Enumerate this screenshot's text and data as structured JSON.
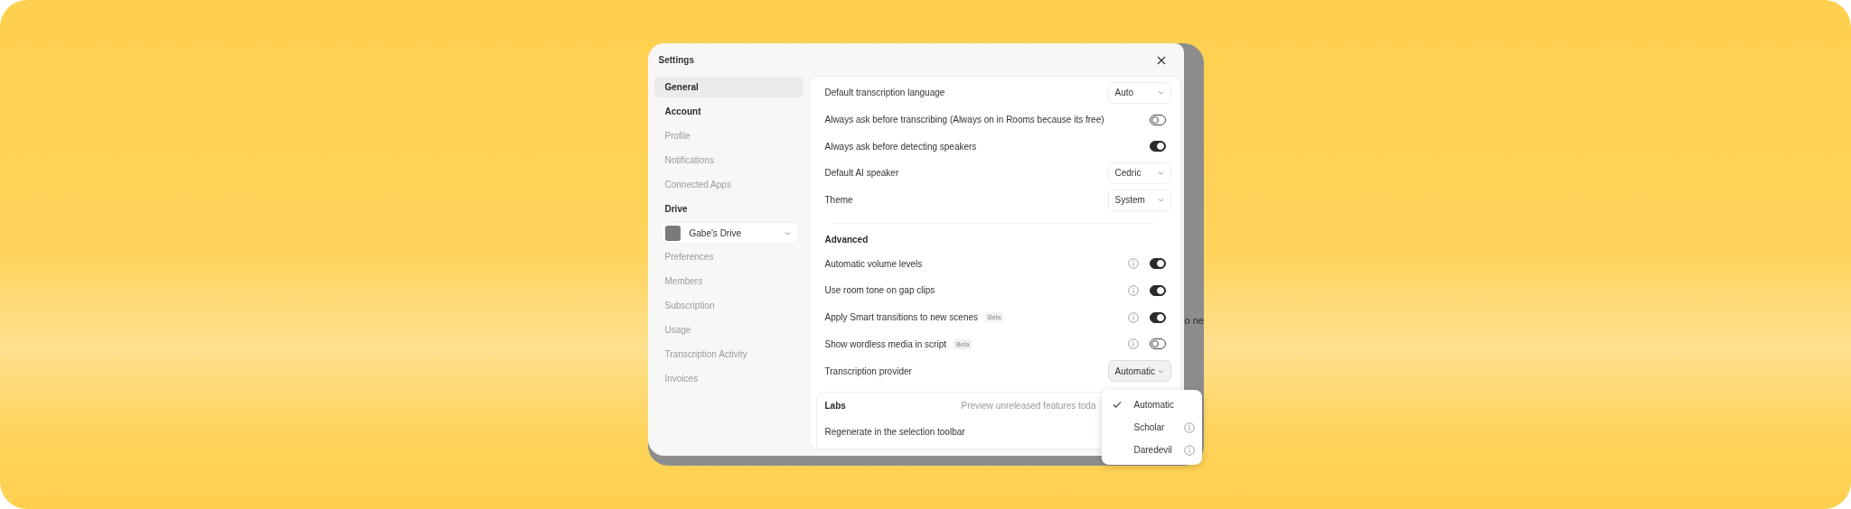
{
  "window": {
    "title": "Settings"
  },
  "background_text": "o ne",
  "sidebar": {
    "items": [
      {
        "kind": "item",
        "label": "General",
        "selected": true
      },
      {
        "kind": "heading",
        "label": "Account"
      },
      {
        "kind": "item",
        "label": "Profile",
        "selected": false
      },
      {
        "kind": "item",
        "label": "Notifications",
        "selected": false
      },
      {
        "kind": "item",
        "label": "Connected Apps",
        "selected": false
      },
      {
        "kind": "heading",
        "label": "Drive"
      },
      {
        "kind": "drive",
        "label": "Gabe's Drive"
      },
      {
        "kind": "item",
        "label": "Preferences",
        "selected": false
      },
      {
        "kind": "item",
        "label": "Members",
        "selected": false
      },
      {
        "kind": "item",
        "label": "Subscription",
        "selected": false
      },
      {
        "kind": "item",
        "label": "Usage",
        "selected": false
      },
      {
        "kind": "item",
        "label": "Transcription Activity",
        "selected": false
      },
      {
        "kind": "item",
        "label": "Invoices",
        "selected": false
      }
    ]
  },
  "general": {
    "rows": [
      {
        "kind": "select",
        "label": "Default transcription language",
        "value": "Auto",
        "open": false
      },
      {
        "kind": "toggle",
        "label": "Always ask before transcribing (Always on in Rooms because its free)",
        "on": false,
        "info": false
      },
      {
        "kind": "toggle",
        "label": "Always ask before detecting speakers",
        "on": true,
        "info": false
      },
      {
        "kind": "select",
        "label": "Default AI speaker",
        "value": "Cedric",
        "open": false
      },
      {
        "kind": "select",
        "label": "Theme",
        "value": "System",
        "open": false
      },
      {
        "kind": "divider"
      },
      {
        "kind": "heading",
        "label": "Advanced"
      },
      {
        "kind": "toggle",
        "label": "Automatic volume levels",
        "on": true,
        "info": true
      },
      {
        "kind": "toggle",
        "label": "Use room tone on gap clips",
        "on": true,
        "info": true
      },
      {
        "kind": "toggle",
        "label": "Apply Smart transitions to new scenes",
        "badge": "Beta",
        "on": true,
        "info": true
      },
      {
        "kind": "toggle",
        "label": "Show wordless media in script",
        "badge": "Beta",
        "on": false,
        "info": true
      },
      {
        "kind": "select",
        "label": "Transcription provider",
        "value": "Automatic",
        "open": true
      }
    ]
  },
  "labs": {
    "title": "Labs",
    "description": "Preview unreleased features toda",
    "items": [
      "Regenerate in the selection toolbar"
    ]
  },
  "provider_menu": {
    "options": [
      {
        "label": "Automatic",
        "selected": true,
        "info": false
      },
      {
        "label": "Scholar",
        "selected": false,
        "info": true
      },
      {
        "label": "Daredevil",
        "selected": false,
        "info": true
      }
    ]
  }
}
